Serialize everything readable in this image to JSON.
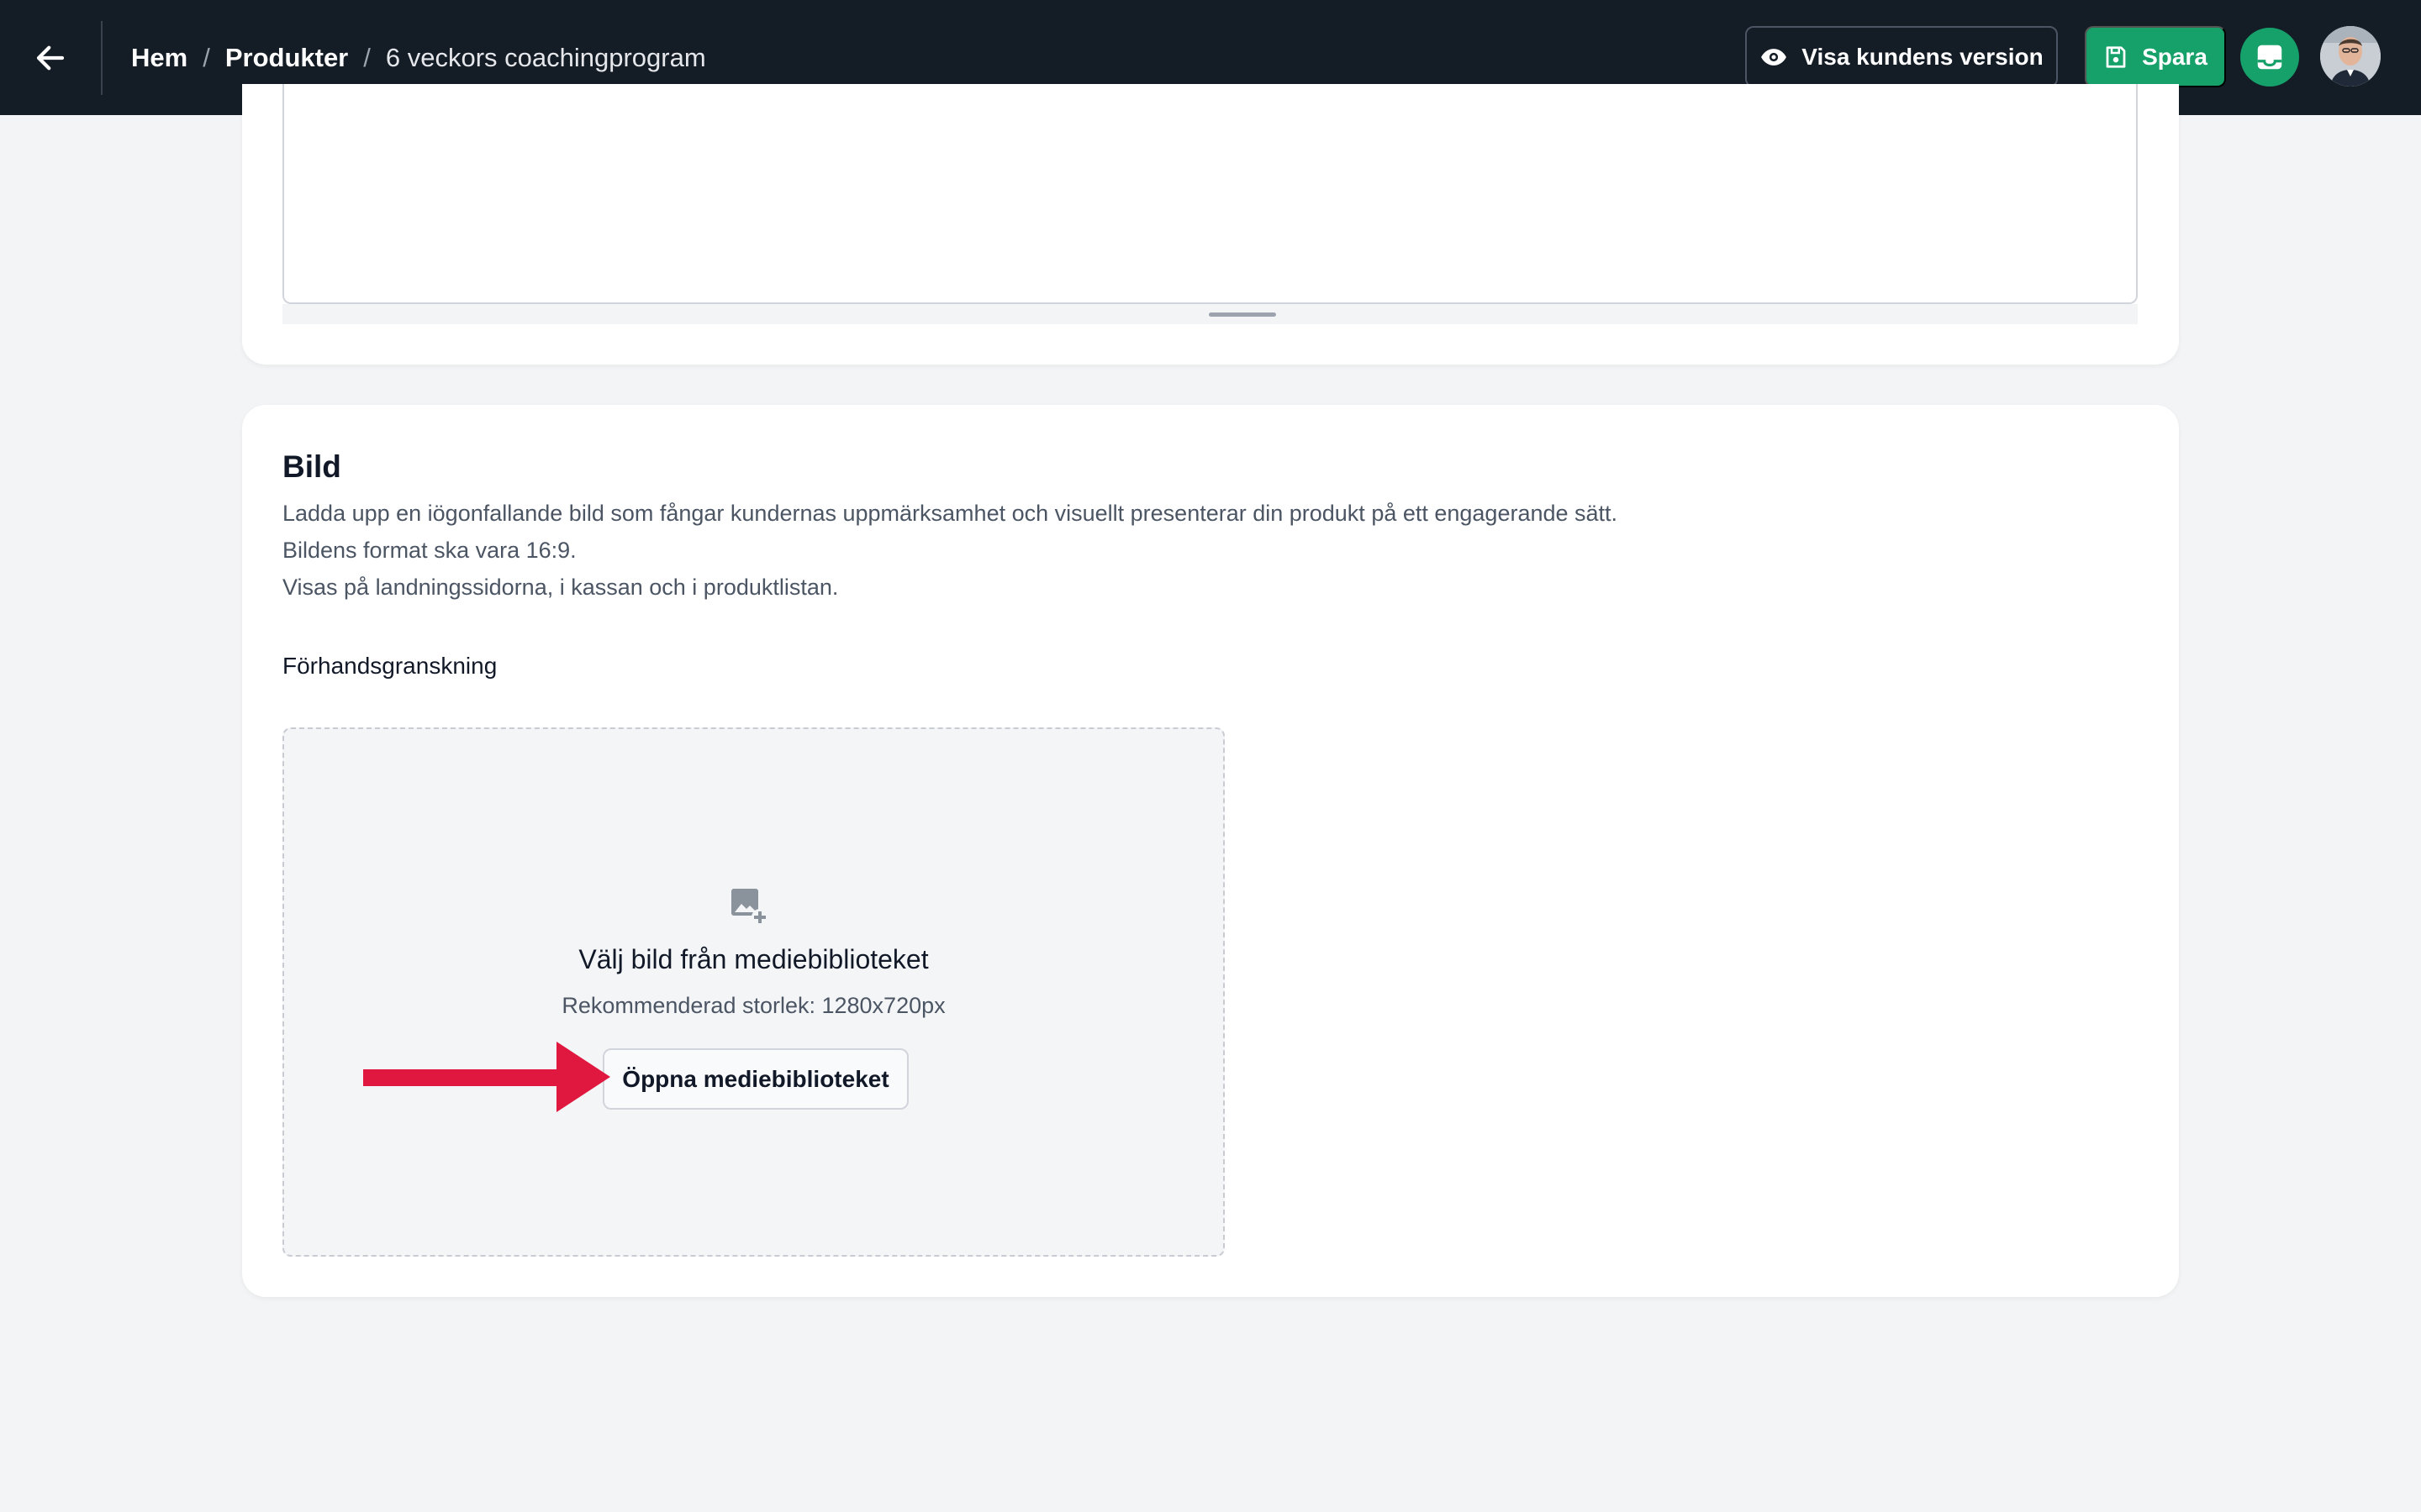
{
  "header": {
    "back_icon": "arrow-left-icon",
    "breadcrumb": [
      {
        "label": "Hem"
      },
      {
        "label": "Produkter"
      }
    ],
    "separator": "/",
    "current": "6 veckors coachingprogram",
    "preview_label": "Visa kundens version",
    "preview_icon": "eye-icon",
    "save_label": "Spara",
    "save_icon": "save-icon",
    "chat_icon": "chat-icon",
    "brand_color": "#16a06a",
    "bar_color": "#141c26"
  },
  "image_section": {
    "title": "Bild",
    "description": [
      "Ladda upp en iögonfallande bild som fångar kundernas uppmärksamhet och visuellt presenterar din produkt på ett engagerande sätt.",
      "Bildens format ska vara 16:9.",
      "Visas på landningssidorna, i kassan och i produktlistan."
    ],
    "preview_label": "Förhandsgranskning",
    "dropzone": {
      "icon": "add-image-icon",
      "title": "Välj bild från mediebiblioteket",
      "subtitle": "Rekommenderad storlek: 1280x720px",
      "button_label": "Öppna mediebiblioteket"
    }
  },
  "annotation": {
    "arrow_color": "#e0173f"
  }
}
